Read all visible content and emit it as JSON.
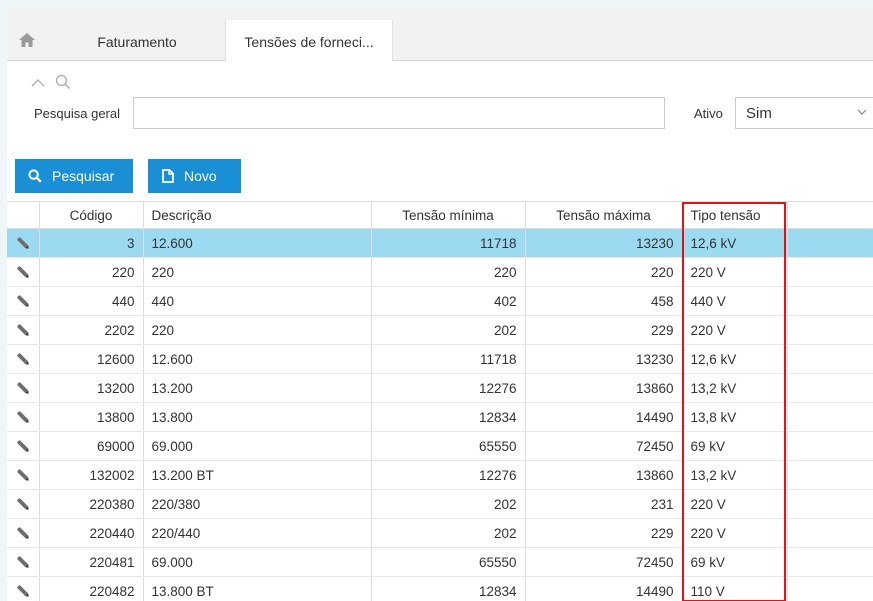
{
  "tabs": {
    "home_icon": "home-icon",
    "items": [
      {
        "label": "Faturamento"
      },
      {
        "label": "Tensões de forneci..."
      }
    ]
  },
  "filter": {
    "search_label": "Pesquisa geral",
    "search_value": "",
    "ativo_label": "Ativo",
    "ativo_value": "Sim"
  },
  "toolbar": {
    "pesquisar_label": "Pesquisar",
    "novo_label": "Novo"
  },
  "colors": {
    "accent": "#1a8fd6",
    "selected_row": "#9bdaf1",
    "highlight_border": "#e3121a"
  },
  "table": {
    "headers": {
      "codigo": "Código",
      "descricao": "Descrição",
      "tensao_minima": "Tensão mínima",
      "tensao_maxima": "Tensão máxima",
      "tipo_tensao": "Tipo tensão"
    },
    "selected_row": 0,
    "rows": [
      {
        "codigo": "3",
        "descricao": "12.600",
        "min": "11718",
        "max": "13230",
        "tipo": "12,6 kV"
      },
      {
        "codigo": "220",
        "descricao": "220",
        "min": "220",
        "max": "220",
        "tipo": "220 V"
      },
      {
        "codigo": "440",
        "descricao": "440",
        "min": "402",
        "max": "458",
        "tipo": "440 V"
      },
      {
        "codigo": "2202",
        "descricao": "220",
        "min": "202",
        "max": "229",
        "tipo": "220 V"
      },
      {
        "codigo": "12600",
        "descricao": "12.600",
        "min": "11718",
        "max": "13230",
        "tipo": "12,6 kV"
      },
      {
        "codigo": "13200",
        "descricao": "13.200",
        "min": "12276",
        "max": "13860",
        "tipo": "13,2 kV"
      },
      {
        "codigo": "13800",
        "descricao": "13.800",
        "min": "12834",
        "max": "14490",
        "tipo": "13,8 kV"
      },
      {
        "codigo": "69000",
        "descricao": "69.000",
        "min": "65550",
        "max": "72450",
        "tipo": "69 kV"
      },
      {
        "codigo": "132002",
        "descricao": "13.200 BT",
        "min": "12276",
        "max": "13860",
        "tipo": "13,2 kV"
      },
      {
        "codigo": "220380",
        "descricao": "220/380",
        "min": "202",
        "max": "231",
        "tipo": "220 V"
      },
      {
        "codigo": "220440",
        "descricao": "220/440",
        "min": "202",
        "max": "229",
        "tipo": "220 V"
      },
      {
        "codigo": "220481",
        "descricao": "69.000",
        "min": "65550",
        "max": "72450",
        "tipo": "69 kV"
      },
      {
        "codigo": "220482",
        "descricao": "13.800 BT",
        "min": "12834",
        "max": "14490",
        "tipo": "110 V"
      }
    ]
  }
}
